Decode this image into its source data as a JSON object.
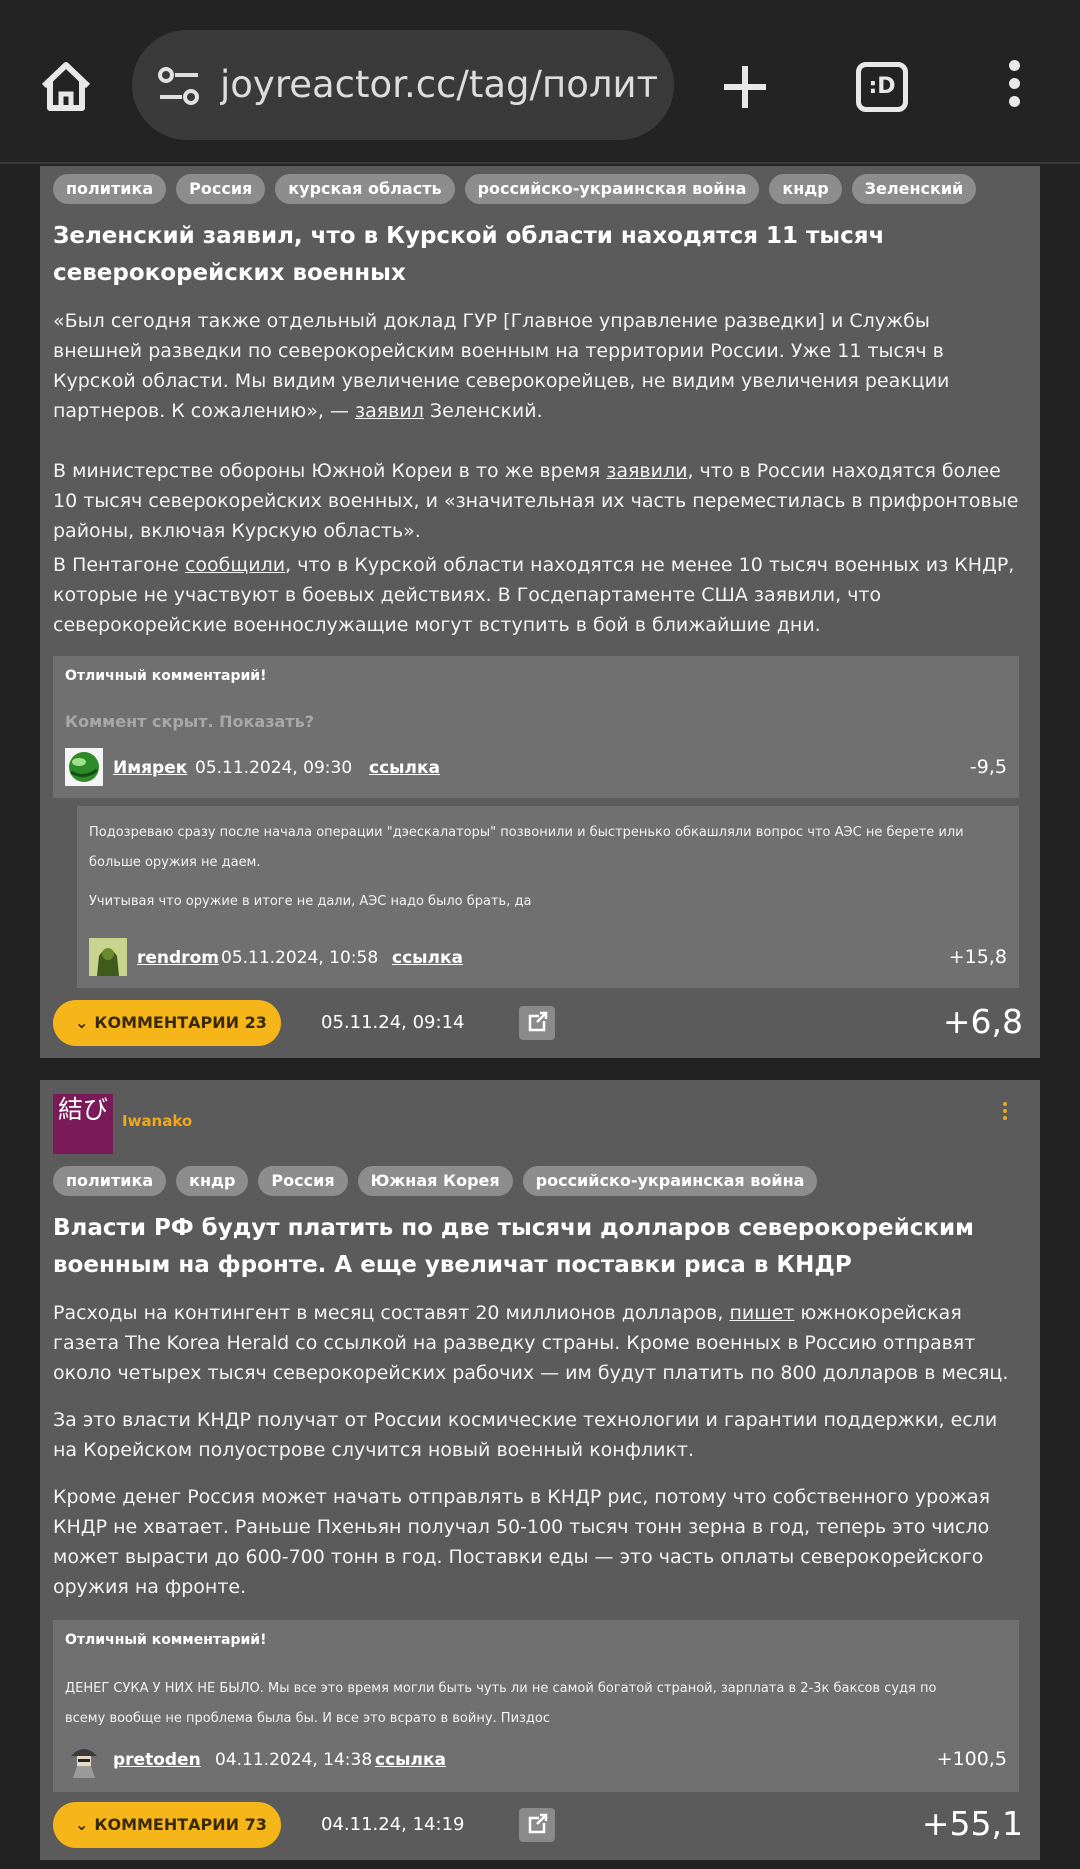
{
  "browser": {
    "url": "joyreactor.cc/tag/политик",
    "tabs_icon": ":D"
  },
  "posts": [
    {
      "tags": [
        "политика",
        "Россия",
        "курская область",
        "российско-украинская война",
        "кндр",
        "Зеленский"
      ],
      "title": "Зеленский заявил, что в Курской области находятся 11 тысяч северокорейских военных",
      "p1_a": "«Был сегодня также отдельный доклад ГУР [Главное управление разведки] и Службы внешней разведки по северокорейским военным на территории России. Уже 11 тысяч в Курской области. Мы видим увеличение северокорейцев, не видим увеличения реакции партнеров. К сожалению», — ",
      "p1_link": "заявил",
      "p1_b": " Зеленский.",
      "p2_a": "В министерстве обороны Южной Кореи в то же время ",
      "p2_link": "заявили",
      "p2_b": ", что в России находятся более 10 тысяч северокорейских военных, и «значительная их часть переместилась в прифронтовые районы, включая Курскую область».",
      "p3_a": "В Пентагоне ",
      "p3_link": "сообщили",
      "p3_b": ", что в Курской области находятся не менее 10 тысяч военных из КНДР, которые не участвуют в боевых действиях. В Госдепартаменте США заявили, что северокорейские военнослужащие могут вступить в бой в ближайшие дни.",
      "top_comment": {
        "header": "Отличный комментарий!",
        "hidden_text": "Коммент скрыт. Показать?",
        "user": "Имярек",
        "date": "05.11.2024, 09:30",
        "link": "ссылка",
        "rating": "-9,5"
      },
      "reply": {
        "text1": "Подозреваю сразу после начала операции \"дэескалаторы\" позвонили и быстренько обкашляли вопрос что АЭС не берете или больше оружия не даем.",
        "text2": "Учитывая что оружие в итоге не дали, АЭС надо было брать, да",
        "user": "rendrom",
        "date": "05.11.2024, 10:58",
        "link": "ссылка",
        "rating": "+15,8"
      },
      "comments_label": "КОММЕНТАРИИ 23",
      "date": "05.11.24, 09:14",
      "rating": "+6,8"
    },
    {
      "author": "Iwanako",
      "author_avatar_text": "結び",
      "tags": [
        "политика",
        "кндр",
        "Россия",
        "Южная Корея",
        "российско-украинская война"
      ],
      "title": "Власти РФ будут платить по две тысячи долларов северокорейским военным на фронте. А еще увеличат поставки риса в КНДР",
      "p1_a": "Расходы на контингент в месяц составят 20 миллионов долларов, ",
      "p1_link": "пишет",
      "p1_b": " южнокорейская газета The Korea Herald со ссылкой на разведку страны. Кроме военных в Россию отправят около четырех тысяч северокорейских рабочих — им будут платить по 800 долларов в месяц.",
      "p2": "За это власти КНДР получат от России космические технологии и гарантии поддержки, если на Корейском полуострове случится новый военный конфликт.",
      "p3": "Кроме денег Россия может начать отправлять в КНДР рис, потому что собственного урожая КНДР не хватает. Раньше Пхеньян получал 50-100 тысяч тонн зерна в год, теперь это число может вырасти до 600-700 тонн в год. Поставки еды — это часть оплаты северокорейского оружия на фронте.",
      "top_comment": {
        "header": "Отличный комментарий!",
        "text": "ДЕНЕГ СУКА У НИХ НЕ БЫЛО. Мы все это время могли быть чуть ли не самой богатой страной, зарплата в 2-3к баксов судя по всему вообще не проблема была бы. И все это всрато в войну. Пиздос",
        "user": "pretoden",
        "date": "04.11.2024, 14:38",
        "link": "ссылка",
        "rating": "+100,5"
      },
      "comments_label": "КОММЕНТАРИИ 73",
      "date": "04.11.24, 14:19",
      "rating": "+55,1"
    }
  ]
}
